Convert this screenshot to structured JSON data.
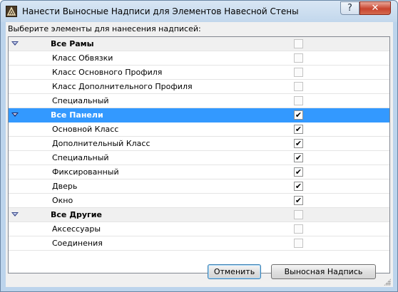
{
  "window": {
    "title": "Нанести Выносные Надписи для Элементов Навесной Стены",
    "help_label": "?",
    "close_label": "✕"
  },
  "instruction": "Выберите элементы для нанесения надписей:",
  "groups": [
    {
      "label": "Все Рамы",
      "checked": false,
      "enabled": false,
      "items": [
        {
          "label": "Класс Обвязки",
          "checked": false,
          "enabled": false
        },
        {
          "label": "Класс Основного Профиля",
          "checked": false,
          "enabled": false
        },
        {
          "label": "Класс Дополнительного Профиля",
          "checked": false,
          "enabled": false
        },
        {
          "label": "Специальный",
          "checked": false,
          "enabled": false
        }
      ]
    },
    {
      "label": "Все Панели",
      "checked": true,
      "enabled": true,
      "selected": true,
      "items": [
        {
          "label": "Основной Класс",
          "checked": true,
          "enabled": true
        },
        {
          "label": "Дополнительный Класс",
          "checked": true,
          "enabled": true
        },
        {
          "label": "Специальный",
          "checked": true,
          "enabled": true
        },
        {
          "label": "Фиксированный",
          "checked": true,
          "enabled": true
        },
        {
          "label": "Дверь",
          "checked": true,
          "enabled": true
        },
        {
          "label": "Окно",
          "checked": true,
          "enabled": true
        }
      ]
    },
    {
      "label": "Все Другие",
      "checked": false,
      "enabled": false,
      "items": [
        {
          "label": "Аксессуары",
          "checked": false,
          "enabled": false
        },
        {
          "label": "Соединения",
          "checked": false,
          "enabled": false
        }
      ]
    }
  ],
  "buttons": {
    "ok_label": "Отменить",
    "callout_label": "Выносная Надпись"
  },
  "colors": {
    "selection": "#3399ff",
    "group_background": "#f0f0f0"
  }
}
